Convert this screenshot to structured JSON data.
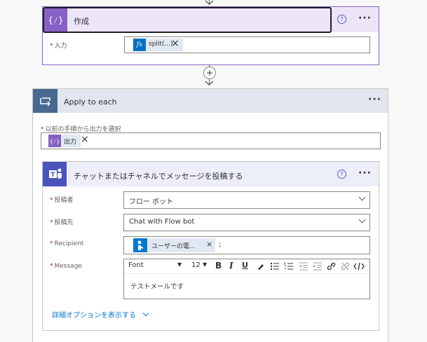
{
  "compose": {
    "title": "作成",
    "input_label": "入力",
    "token_label": "split(...)",
    "token_icon": "fx"
  },
  "apply": {
    "title": "Apply to each",
    "select_label": "以前の手順から出力を選択",
    "token_label": "出力"
  },
  "teams": {
    "title": "チャットまたはチャネルでメッセージを投稿する",
    "poster_label": "投稿者",
    "poster_value": "フロー ボット",
    "post_in_label": "投稿先",
    "post_in_value": "Chat with Flow bot",
    "recipient_label": "Recipient",
    "recipient_token": "ユーザーの電...",
    "recipient_sep": ";",
    "message_label": "Message",
    "font_value": "Font",
    "size_value": "12",
    "message_text": "テストメールです",
    "advanced_link": "詳細オプションを表示する"
  },
  "common": {
    "required_mark": "*",
    "help_glyph": "?",
    "more_glyph": "···",
    "remove_glyph": "×",
    "add_glyph": "+"
  },
  "colors": {
    "compose_accent": "#8661c5",
    "compose_header_bg": "#ebe5f7",
    "loop_accent": "#486991",
    "loop_header_bg": "#e1e6ee",
    "teams_accent": "#4b53bc",
    "teams_header_bg": "#eceef8",
    "link": "#0078d4"
  },
  "icons": [
    "compose-icon",
    "loop-icon",
    "teams-icon",
    "fx-icon",
    "user-icon",
    "help-icon",
    "more-icon",
    "remove-icon",
    "add-step-icon",
    "chevron-down-icon",
    "bold-icon",
    "italic-icon",
    "underline-icon",
    "highlight-icon",
    "bullet-list-icon",
    "numbered-list-icon",
    "outdent-icon",
    "indent-icon",
    "link-icon",
    "unlink-icon",
    "code-icon"
  ]
}
